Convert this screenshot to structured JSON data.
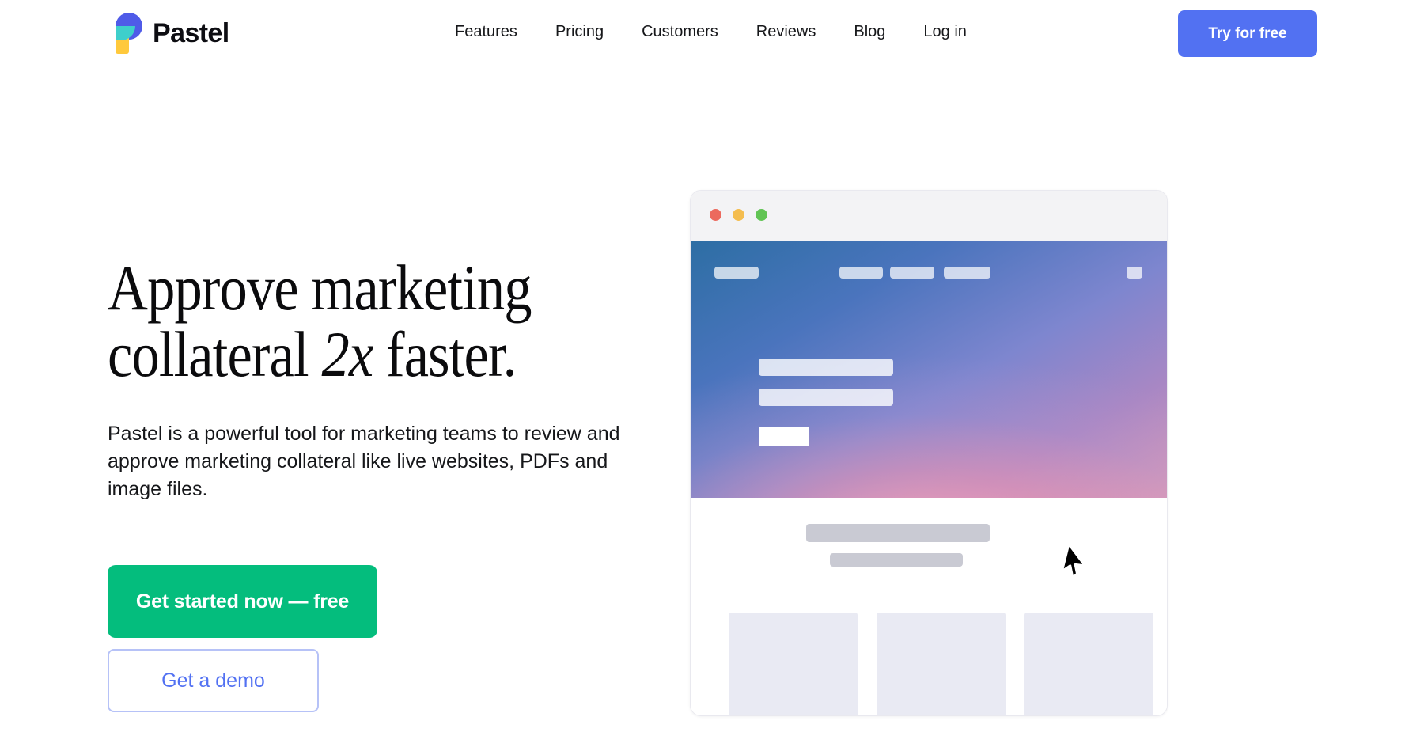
{
  "header": {
    "brand": {
      "name": "Pastel",
      "logo_icon": "pastel-logo-icon"
    },
    "nav": [
      {
        "label": "Features"
      },
      {
        "label": "Pricing"
      },
      {
        "label": "Customers"
      },
      {
        "label": "Reviews"
      },
      {
        "label": "Blog"
      },
      {
        "label": "Log in"
      }
    ],
    "cta": {
      "label": "Try for free",
      "color": "#5271f2"
    }
  },
  "hero": {
    "headline_line1": "Approve marketing",
    "headline_line2_pre": "collateral ",
    "headline_emphasis": "2x",
    "headline_line2_post": " faster.",
    "subtext": "Pastel is a powerful tool for marketing teams to review and approve marketing collateral like live websites, PDFs and image files.",
    "primary_cta": {
      "label": "Get started now — free",
      "color": "#04bd7d"
    },
    "secondary_cta": {
      "label": "Get a demo",
      "color": "#5271f2",
      "border_color": "#b6c2f7"
    }
  },
  "mockup": {
    "window_controls": [
      {
        "name": "close-dot",
        "color": "#ec6a5e"
      },
      {
        "name": "minimize-dot",
        "color": "#f4bd4f"
      },
      {
        "name": "maximize-dot",
        "color": "#61c454"
      }
    ],
    "hero_gradient": {
      "from": "#2d6ea4",
      "mid": "#7e86cf",
      "to": "#f8a4b7"
    },
    "nav_placeholders": 5,
    "hero_text_placeholders": 2,
    "hero_button_placeholder": 1,
    "body_text_placeholders": 2,
    "card_placeholders": 3,
    "cursor_icon": "mouse-pointer-icon"
  }
}
